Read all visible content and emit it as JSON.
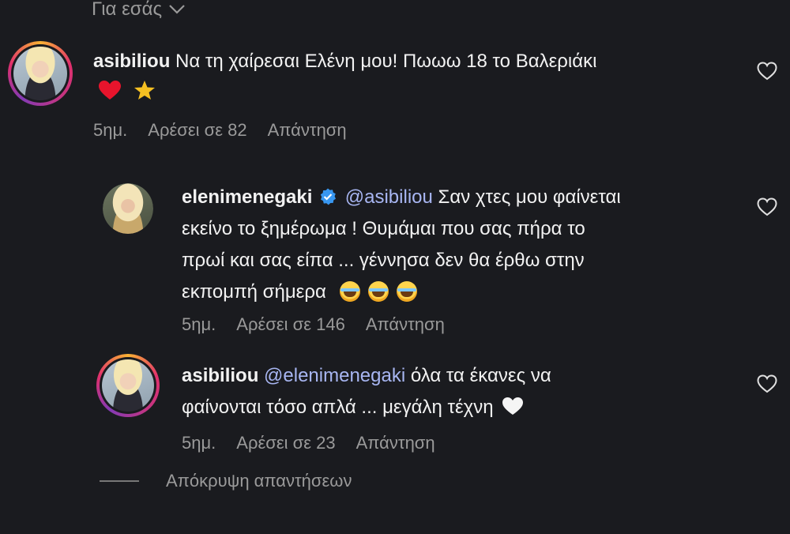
{
  "filter": {
    "label": "Για εσάς"
  },
  "comments": [
    {
      "username": "asibiliou",
      "text": "Να τη χαίρεσαι Ελένη μου! Πωωω 18 το Βαλεριάκι",
      "time": "5ημ.",
      "likes": "Αρέσει σε 82",
      "reply": "Απάντηση"
    },
    {
      "username": "elenimenegaki",
      "mention": "@asibiliou",
      "line1": "Σαν χτες μου φαίνεται",
      "line2": "εκείνο το ξημέρωμα ! Θυμάμαι που σας πήρα το",
      "line3": "πρωί και σας είπα ... γέννησα δεν θα έρθω στην",
      "line4": "εκπομπή σήμερα",
      "time": "5ημ.",
      "likes": "Αρέσει σε 146",
      "reply": "Απάντηση"
    },
    {
      "username": "asibiliou",
      "mention": "@elenimenegaki",
      "line1": "όλα τα έκανες να",
      "line2": "φαίνονται τόσο απλά ... μεγάλη τέχνη",
      "time": "5ημ.",
      "likes": "Αρέσει σε 23",
      "reply": "Απάντηση"
    }
  ],
  "hide_replies": {
    "label": "Απόκρυψη απαντήσεων"
  },
  "colors": {
    "background": "#1a1b1f",
    "mention": "#a8b6f2",
    "verified": "#3897f0",
    "heart": "#e8142c"
  }
}
